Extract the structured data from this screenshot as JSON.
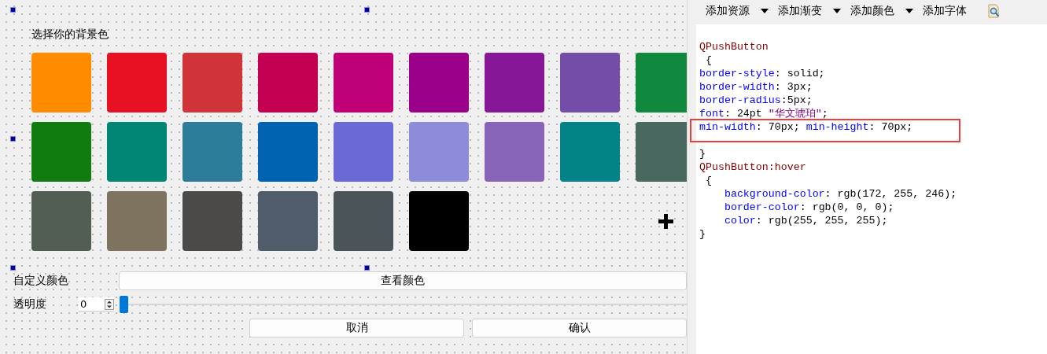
{
  "designer": {
    "title": "选择你的背景色",
    "swatches": [
      {
        "color": "#ff8c00"
      },
      {
        "color": "#e81123"
      },
      {
        "color": "#d13438"
      },
      {
        "color": "#c30052"
      },
      {
        "color": "#bf0077"
      },
      {
        "color": "#9a0089"
      },
      {
        "color": "#881798"
      },
      {
        "color": "#744da9"
      },
      {
        "color": "#10893e"
      },
      {
        "color": "#107c10"
      },
      {
        "color": "#018574"
      },
      {
        "color": "#2d7d9a"
      },
      {
        "color": "#0063b1"
      },
      {
        "color": "#6b69d6"
      },
      {
        "color": "#8e8cd8"
      },
      {
        "color": "#8764b8"
      },
      {
        "color": "#038387"
      },
      {
        "color": "#486860"
      },
      {
        "color": "#525e54"
      },
      {
        "color": "#7e735f"
      },
      {
        "color": "#4c4a48"
      },
      {
        "color": "#515c6b"
      },
      {
        "color": "#4a5459"
      },
      {
        "color": "#000000"
      }
    ],
    "custom_color": {
      "label": "自定义颜色",
      "button": "查看颜色"
    },
    "opacity": {
      "label": "透明度",
      "value": "0",
      "level": 0
    },
    "buttons": [
      "取消",
      "确认"
    ]
  },
  "editor": {
    "toolbar": [
      {
        "label": "添加资源",
        "has_menu": true
      },
      {
        "label": "添加渐变",
        "has_menu": true
      },
      {
        "label": "添加颜色",
        "has_menu": true
      },
      {
        "label": "添加字体",
        "has_menu": false
      }
    ],
    "lines": [
      {
        "highlighted": false,
        "indented": false,
        "segments": [
          {
            "kind": "selector",
            "text": "QPushButton"
          }
        ]
      },
      {
        "highlighted": false,
        "indented": false,
        "segments": [
          {
            "kind": "plain",
            "text": " {"
          }
        ]
      },
      {
        "highlighted": false,
        "indented": false,
        "segments": [
          {
            "kind": "property",
            "text": "border-style"
          },
          {
            "kind": "plain",
            "text": ": solid;"
          }
        ]
      },
      {
        "highlighted": false,
        "indented": false,
        "segments": [
          {
            "kind": "property",
            "text": "border-width"
          },
          {
            "kind": "plain",
            "text": ": 3px;"
          }
        ]
      },
      {
        "highlighted": false,
        "indented": false,
        "segments": [
          {
            "kind": "property",
            "text": "border-radius"
          },
          {
            "kind": "plain",
            "text": ":5px;"
          }
        ]
      },
      {
        "highlighted": false,
        "indented": false,
        "segments": [
          {
            "kind": "property",
            "text": "font"
          },
          {
            "kind": "plain",
            "text": ": 24pt "
          },
          {
            "kind": "string",
            "text": "\"华文琥珀\""
          },
          {
            "kind": "plain",
            "text": ";"
          }
        ]
      },
      {
        "highlighted": true,
        "indented": false,
        "segments": [
          {
            "kind": "property",
            "text": "min-width"
          },
          {
            "kind": "plain",
            "text": ": 70px; "
          },
          {
            "kind": "property",
            "text": "min-height"
          },
          {
            "kind": "plain",
            "text": ": 70px;"
          }
        ]
      },
      {
        "highlighted": false,
        "indented": false,
        "segments": [
          {
            "kind": "plain",
            "text": "}"
          }
        ]
      },
      {
        "highlighted": false,
        "indented": false,
        "segments": [
          {
            "kind": "selector",
            "text": "QPushButton:hover"
          }
        ]
      },
      {
        "highlighted": false,
        "indented": false,
        "segments": [
          {
            "kind": "plain",
            "text": " {"
          }
        ]
      },
      {
        "highlighted": false,
        "indented": true,
        "segments": [
          {
            "kind": "property",
            "text": "background-color"
          },
          {
            "kind": "plain",
            "text": ": rgb(172, 255, 246);"
          }
        ]
      },
      {
        "highlighted": false,
        "indented": true,
        "segments": [
          {
            "kind": "property",
            "text": "border-color"
          },
          {
            "kind": "plain",
            "text": ": rgb(0, 0, 0);"
          }
        ]
      },
      {
        "highlighted": false,
        "indented": true,
        "segments": [
          {
            "kind": "property",
            "text": "color"
          },
          {
            "kind": "plain",
            "text": ": rgb(255, 255, 255);"
          }
        ]
      },
      {
        "highlighted": false,
        "indented": false,
        "segments": [
          {
            "kind": "plain",
            "text": "}"
          }
        ]
      }
    ]
  }
}
